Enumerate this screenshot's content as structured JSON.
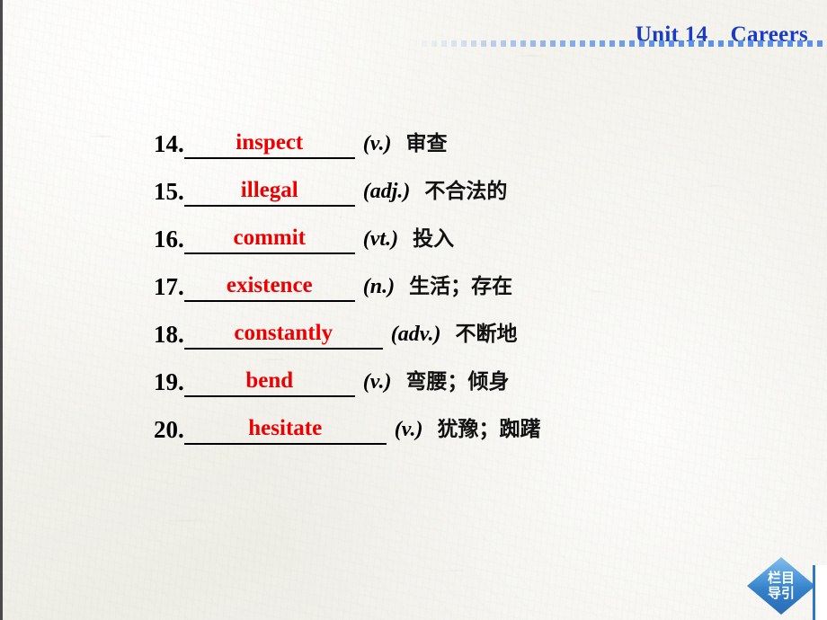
{
  "header": {
    "title": "Unit 14　Careers",
    "accent_color": "#1a3cc0",
    "rule_color": "#5b91e8"
  },
  "colors": {
    "answer_red": "#ee0000",
    "header_blue": "#1a3cc0",
    "badge_blue": "#3380c9",
    "paper": "#f3f2ec"
  },
  "vocab": {
    "rows": [
      {
        "number": "14.",
        "answer": "inspect",
        "pos": "(v.)",
        "gloss": "审查",
        "blank_width": 190
      },
      {
        "number": "15.",
        "answer": "illegal",
        "pos": "(adj.)",
        "gloss": "不合法的",
        "blank_width": 190
      },
      {
        "number": "16.",
        "answer": "commit",
        "pos": "(vt.)",
        "gloss": "投入",
        "blank_width": 190
      },
      {
        "number": "17.",
        "answer": "existence",
        "pos": "(n.)",
        "gloss": "生活；存在",
        "blank_width": 190
      },
      {
        "number": "18.",
        "answer": "constantly",
        "pos": "(adv.)",
        "gloss": "不断地",
        "blank_width": 221
      },
      {
        "number": "19.",
        "answer": "bend",
        "pos": "(v.)",
        "gloss": "弯腰；倾身",
        "blank_width": 190
      },
      {
        "number": "20.",
        "answer": "hesitate",
        "pos": "(v.)",
        "gloss": "犹豫；踟躇",
        "blank_width": 225
      }
    ]
  },
  "nav_badge": {
    "line1": "栏目",
    "line2": "导引"
  }
}
